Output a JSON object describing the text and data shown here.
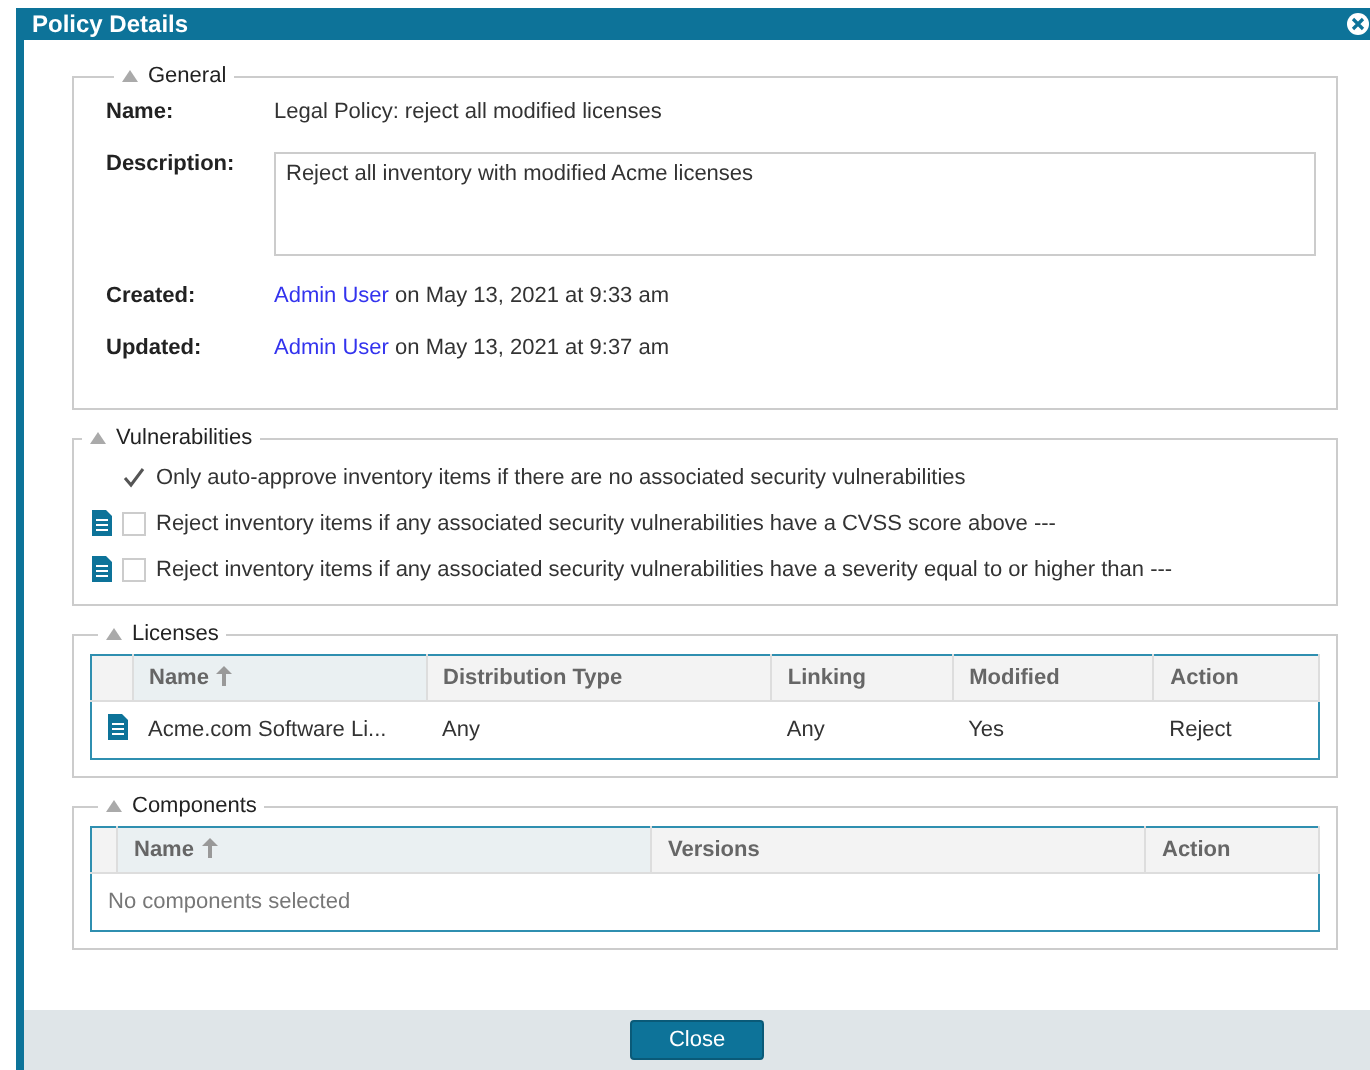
{
  "window": {
    "title": "Policy Details"
  },
  "general": {
    "title": "General",
    "expanded": true,
    "name_label": "Name:",
    "name": "Legal Policy: reject all modified licenses",
    "description_label": "Description:",
    "description": "Reject all inventory with modified Acme licenses",
    "created_label": "Created:",
    "created_user": "Admin User",
    "created_text": "on May 13, 2021 at 9:33 am",
    "updated_label": "Updated:",
    "updated_user": "Admin User",
    "updated_text": "on May 13, 2021 at 9:37 am"
  },
  "vulnerabilities": {
    "title": "Vulnerabilities",
    "expanded": true,
    "options": [
      {
        "label": "Only auto-approve inventory items if there are no associated security vulnerabilities",
        "checked": true,
        "doc_icon": false
      },
      {
        "label": "Reject inventory items if any associated security vulnerabilities have a CVSS score above ---",
        "checked": false,
        "doc_icon": true
      },
      {
        "label": "Reject inventory items if any associated security vulnerabilities have a severity equal to or higher than ---",
        "checked": false,
        "doc_icon": true
      }
    ]
  },
  "licenses": {
    "title": "Licenses",
    "expanded": true,
    "columns": [
      "Name",
      "Distribution Type",
      "Linking",
      "Modified",
      "Action"
    ],
    "rows": [
      {
        "cells": [
          "Acme.com Software Li...",
          "Any",
          "Any",
          "Yes",
          "Reject"
        ]
      }
    ]
  },
  "components": {
    "title": "Components",
    "expanded": true,
    "columns": [
      "Name",
      "Versions",
      "Action"
    ],
    "empty": "No components selected"
  },
  "buttons": [
    "Close"
  ]
}
